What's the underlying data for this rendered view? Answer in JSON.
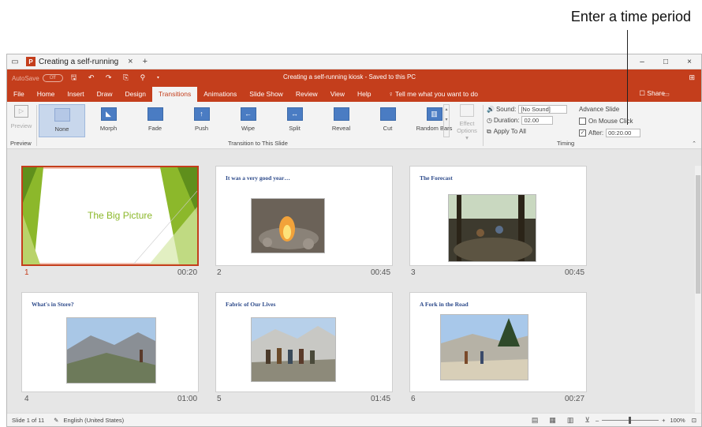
{
  "callout": {
    "text": "Enter a time period"
  },
  "titlebar": {
    "doc_tab": "Creating a self-running",
    "close": "×",
    "new_tab": "+",
    "min": "–",
    "max": "□",
    "close_win": "×"
  },
  "qat": {
    "autosave": "AutoSave",
    "toggle": "Off",
    "icons": "🖫 ↶ ↷ ⎘ ⚲ ▾",
    "doc_title": "Creating a self-running kiosk - Saved to this PC",
    "ribbon_display": "⊞"
  },
  "menu": {
    "items": [
      "File",
      "Home",
      "Insert",
      "Draw",
      "Design",
      "Transitions",
      "Animations",
      "Slide Show",
      "Review",
      "View",
      "Help"
    ],
    "tell_me": "♀  Tell me what you want to do",
    "share": "☐ Share"
  },
  "ribbon": {
    "preview_label": "Preview",
    "preview_group": "Preview",
    "transitions": [
      "None",
      "Morph",
      "Fade",
      "Push",
      "Wipe",
      "Split",
      "Reveal",
      "Cut",
      "Random Bars"
    ],
    "transition_group": "Transition to This Slide",
    "effect_options": "Effect Options ▾",
    "sound_label": "Sound:",
    "sound_value": "[No Sound]",
    "duration_label": "Duration:",
    "duration_value": "02.00",
    "apply_all": "Apply To All",
    "timing_group": "Timing",
    "advance_label": "Advance Slide",
    "on_click": "On Mouse Click",
    "after_label": "After:",
    "after_value": "00:20.00"
  },
  "slides": [
    {
      "num": "1",
      "title": "The Big Picture",
      "duration": "00:20"
    },
    {
      "num": "2",
      "title": "It was a very good year…",
      "duration": "00:45"
    },
    {
      "num": "3",
      "title": "The Forecast",
      "duration": "00:45"
    },
    {
      "num": "4",
      "title": "What's in Store?",
      "duration": "01:00"
    },
    {
      "num": "5",
      "title": "Fabric of Our Lives",
      "duration": "01:45"
    },
    {
      "num": "6",
      "title": "A Fork in the Road",
      "duration": "00:27"
    }
  ],
  "status": {
    "slide": "Slide 1 of 11",
    "language": "English (United States)",
    "zoom": "100%"
  },
  "colors": {
    "accent": "#c43e1c",
    "title_blue": "#2d4a8a",
    "big_picture_green": "#8cb82b"
  }
}
